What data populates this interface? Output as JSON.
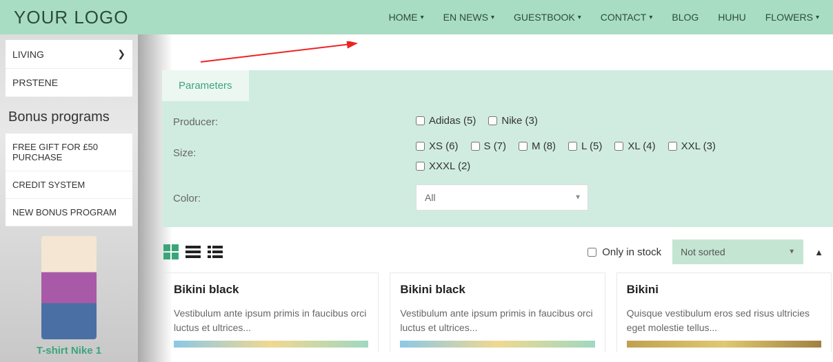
{
  "logo": "YOUR LOGO",
  "nav": [
    {
      "label": "HOME",
      "dropdown": true
    },
    {
      "label": "EN NEWS",
      "dropdown": true
    },
    {
      "label": "GUESTBOOK",
      "dropdown": true
    },
    {
      "label": "CONTACT",
      "dropdown": true
    },
    {
      "label": "BLOG",
      "dropdown": false
    },
    {
      "label": "HUHU",
      "dropdown": false
    },
    {
      "label": "FLOWERS",
      "dropdown": true
    }
  ],
  "sidebar": {
    "categories": [
      {
        "label": "LIVING",
        "arrow": true
      },
      {
        "label": "PRSTENE",
        "arrow": false
      }
    ],
    "bonus_title": "Bonus programs",
    "bonus_items": [
      {
        "label": "FREE GIFT FOR £50 PURCHASE"
      },
      {
        "label": "CREDIT SYSTEM"
      },
      {
        "label": "NEW BONUS PROGRAM"
      }
    ],
    "promo_title": "T-shirt Nike 1"
  },
  "filters": {
    "tab_label": "Parameters",
    "producer_label": "Producer:",
    "producer_options": [
      {
        "label": "Adidas (5)"
      },
      {
        "label": "Nike (3)"
      }
    ],
    "size_label": "Size:",
    "size_options": [
      {
        "label": "XS (6)"
      },
      {
        "label": "S (7)"
      },
      {
        "label": "M (8)"
      },
      {
        "label": "L (5)"
      },
      {
        "label": "XL (4)"
      },
      {
        "label": "XXL (3)"
      },
      {
        "label": "XXXL (2)"
      }
    ],
    "color_label": "Color:",
    "color_selected": "All"
  },
  "toolbar": {
    "only_stock_label": "Only in stock",
    "sort_selected": "Not sorted"
  },
  "products": [
    {
      "title": "Bikini black",
      "desc": "Vestibulum ante ipsum primis in faucibus orci luctus et ultrices..."
    },
    {
      "title": "Bikini black",
      "desc": "Vestibulum ante ipsum primis in faucibus orci luctus et ultrices..."
    },
    {
      "title": "Bikini",
      "desc": "Quisque vestibulum eros sed risus ultricies eget molestie tellus..."
    }
  ]
}
